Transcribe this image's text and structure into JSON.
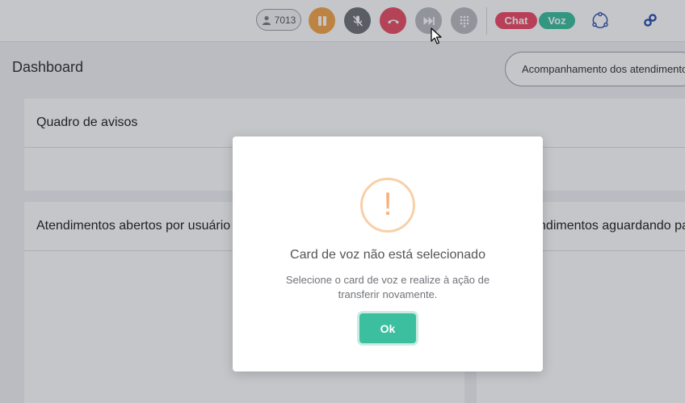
{
  "topbar": {
    "extension": "7013",
    "badges": {
      "chat": "Chat",
      "voz": "Voz"
    }
  },
  "dashboard": {
    "title": "Dashboard",
    "tracking_button": "Acompanhamento dos atendimentos"
  },
  "cards": {
    "notices": "Quadro de avisos",
    "open": "Atendimentos abertos por usuário",
    "waiting": "Atendimentos aguardando para serem atendidos"
  },
  "modal": {
    "icon": "!",
    "title": "Card de voz não está selecionado",
    "message": "Selecione o card de voz e realize à ação de transferir novamente.",
    "ok": "Ok"
  },
  "colors": {
    "pause": "#f5a54a",
    "mute": "#6f7276",
    "hangup": "#e84f67",
    "chat": "#ee4a66",
    "voz": "#3bbf9e",
    "ok": "#3bbf9e",
    "warning": "#f5b27a"
  },
  "icons": [
    "user-icon",
    "pause-icon",
    "mic-off-icon",
    "phone-hangup-icon",
    "skip-forward-icon",
    "dialpad-icon",
    "network-icon",
    "link-icon",
    "alert-icon"
  ]
}
